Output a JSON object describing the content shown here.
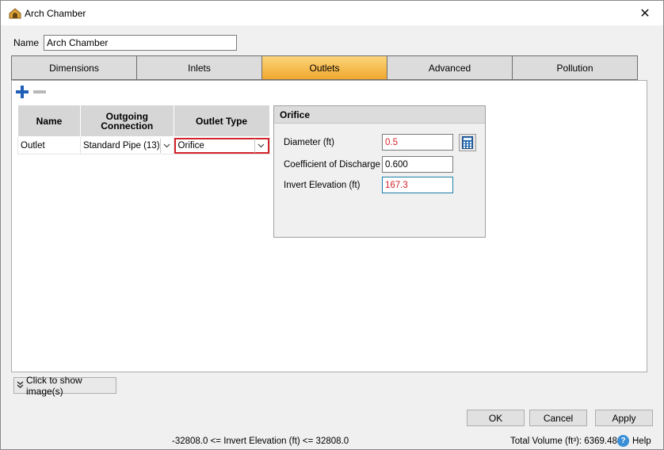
{
  "window": {
    "title": "Arch Chamber",
    "close_glyph": "✕"
  },
  "name_field": {
    "label": "Name",
    "value": "Arch Chamber"
  },
  "tabs": [
    {
      "label": "Dimensions",
      "active": false
    },
    {
      "label": "Inlets",
      "active": false
    },
    {
      "label": "Outlets",
      "active": true
    },
    {
      "label": "Advanced",
      "active": false
    },
    {
      "label": "Pollution",
      "active": false
    }
  ],
  "outlets_grid": {
    "headers": {
      "name": "Name",
      "outgoing_connection": "Outgoing Connection",
      "outlet_type": "Outlet Type"
    },
    "rows": [
      {
        "name": "Outlet",
        "outgoing_connection": "Standard Pipe (13)",
        "outlet_type": "Orifice"
      }
    ]
  },
  "orifice": {
    "title": "Orifice",
    "fields": [
      {
        "label": "Diameter (ft)",
        "value": "0.5"
      },
      {
        "label": "Coefficient of Discharge",
        "value": "0.600"
      },
      {
        "label": "Invert Elevation (ft)",
        "value": "167.3"
      }
    ]
  },
  "show_image_button": "Click to show image(s)",
  "buttons": {
    "ok": "OK",
    "cancel": "Cancel",
    "apply": "Apply"
  },
  "status": {
    "range": "-32808.0 <= Invert Elevation (ft) <= 32808.0",
    "total_volume": "Total Volume (ft³): 6369.484",
    "help": "Help"
  },
  "colors": {
    "active_tab": "#f0a72e",
    "error_red": "#d2232a",
    "add_blue": "#1f5fb5"
  }
}
